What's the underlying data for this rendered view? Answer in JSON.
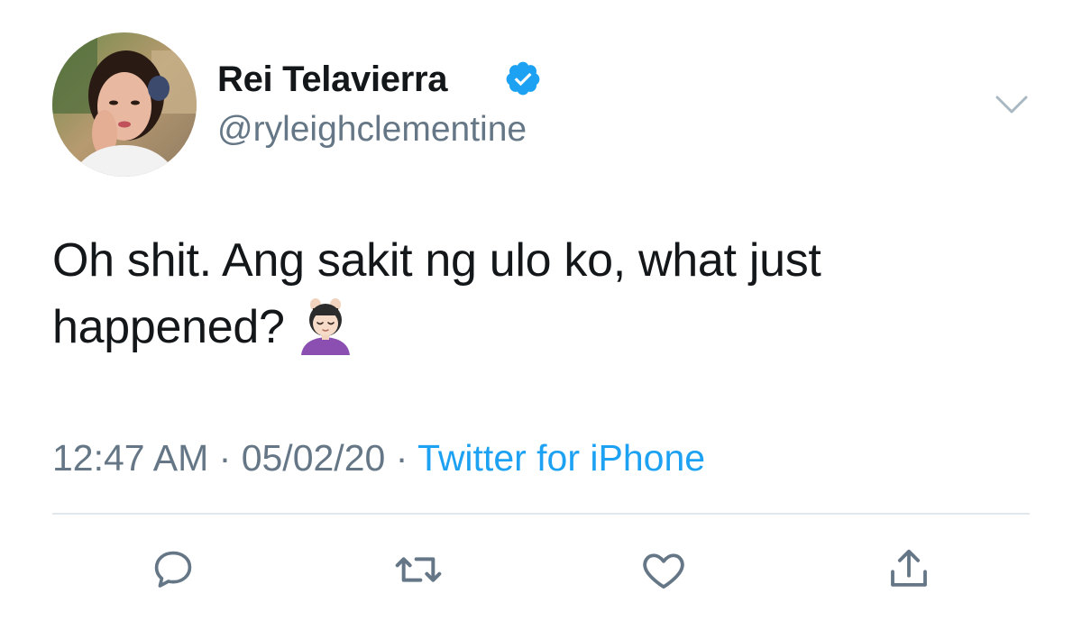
{
  "tweet": {
    "display_name": "Rei Telavierra",
    "handle": "@ryleighclementine",
    "verified": true,
    "text": "Oh shit. Ang sakit ng ulo ko, what just happened?",
    "emoji": "head-massage-emoji",
    "time": "12:47 AM",
    "date": "05/02/20",
    "separator": "·",
    "source": "Twitter for iPhone"
  },
  "icons": {
    "verified": "verified-badge-icon",
    "more": "chevron-down-icon",
    "reply": "reply-icon",
    "retweet": "retweet-icon",
    "like": "heart-icon",
    "share": "share-icon"
  },
  "colors": {
    "text": "#14171a",
    "secondary": "#657786",
    "accent": "#1da1f2",
    "divider": "#e1e8ed"
  }
}
